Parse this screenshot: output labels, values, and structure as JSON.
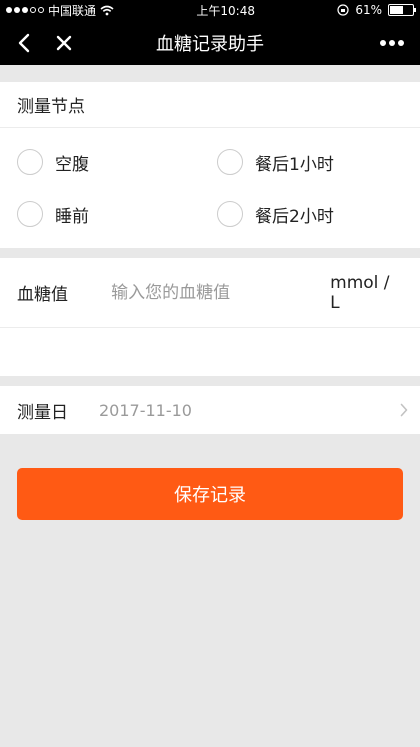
{
  "status_bar": {
    "carrier": "中国联通",
    "time": "上午10:48",
    "battery": "61%",
    "battery_level": 0.61,
    "icons": [
      "signal-dots-icon",
      "wifi-icon",
      "orientation-lock-icon",
      "battery-icon"
    ]
  },
  "nav": {
    "title": "血糖记录助手",
    "icons": [
      "back-arrow-icon",
      "close-icon",
      "more-dots-icon"
    ]
  },
  "measure_point": {
    "title": "测量节点",
    "options": [
      {
        "label": "空腹",
        "checked": true
      },
      {
        "label": "餐后1小时",
        "checked": false
      },
      {
        "label": "睡前",
        "checked": false
      },
      {
        "label": "餐后2小时",
        "checked": false
      }
    ]
  },
  "glucose": {
    "label": "血糖值",
    "placeholder": "输入您的血糖值",
    "value": "",
    "unit": "mmol / L"
  },
  "date": {
    "label": "测量日",
    "value": "2017-11-10"
  },
  "save_button": {
    "label": "保存记录"
  },
  "colors": {
    "accent": "#ff5a14",
    "background": "#e8e8e8",
    "bar": "#000000"
  }
}
